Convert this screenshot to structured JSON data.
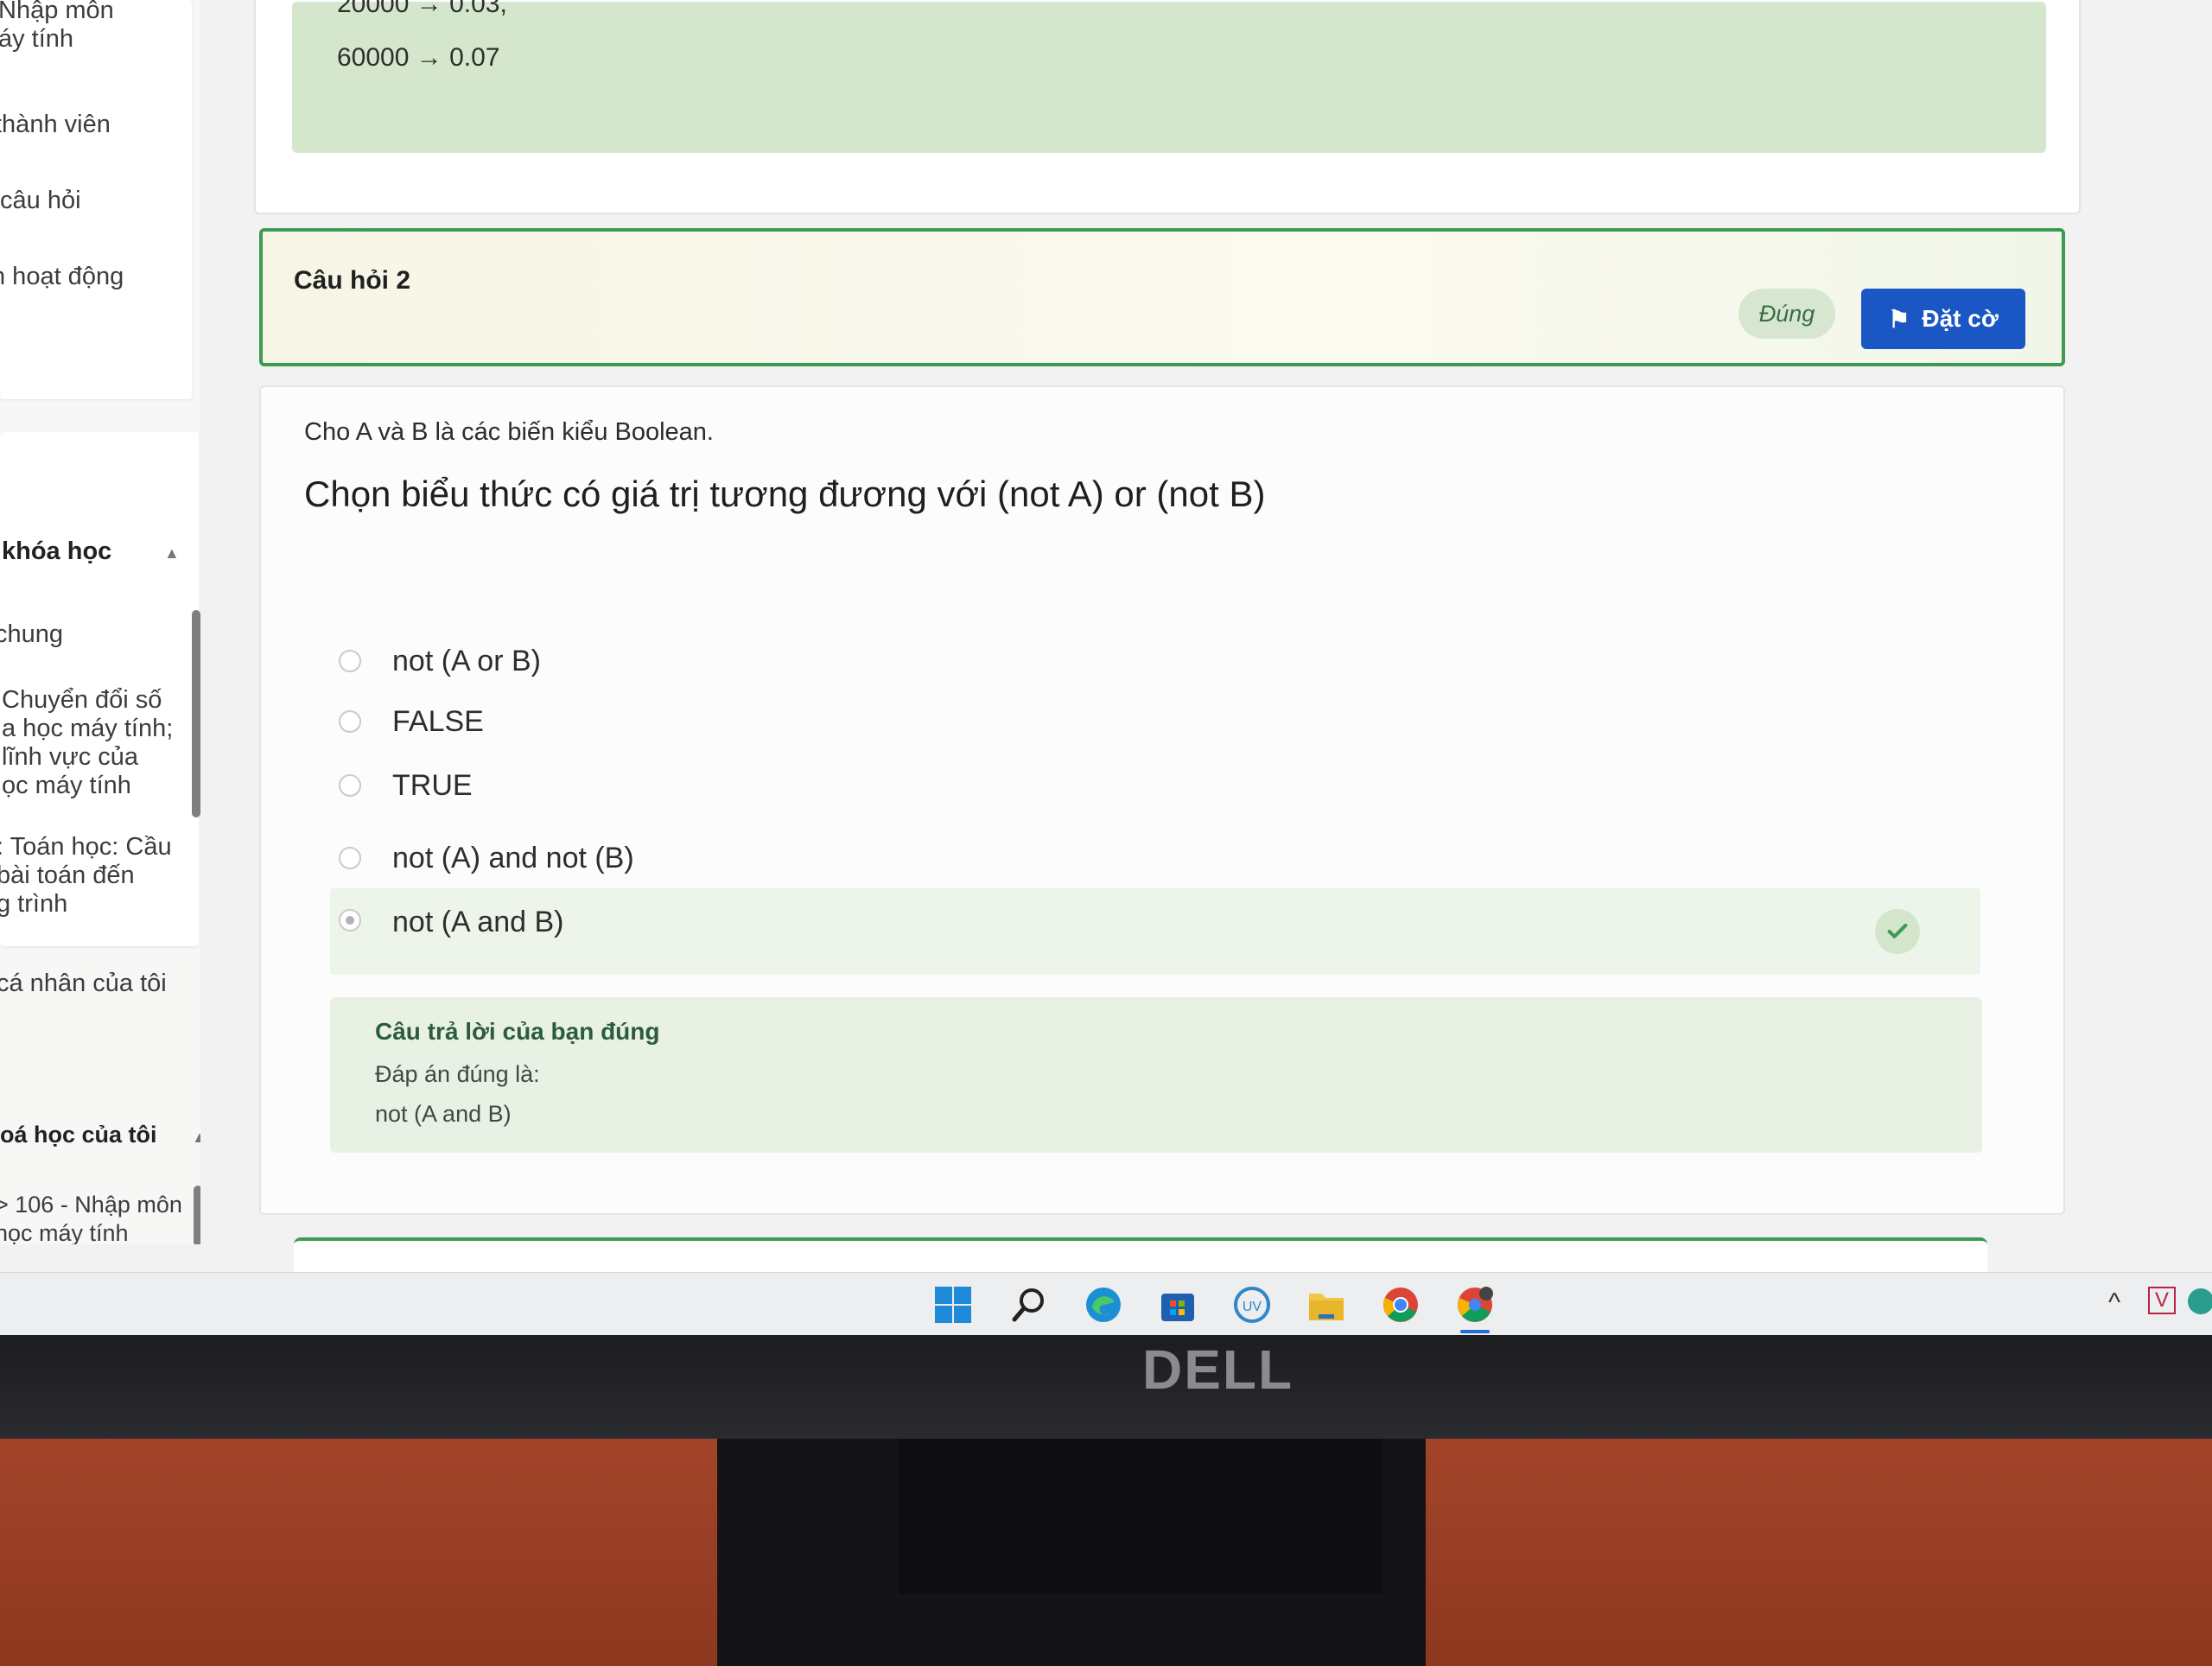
{
  "sidebar": {
    "course_title": "Nhập môn\náy tính",
    "nav_items": [
      "thành viên",
      "câu hỏi",
      "h hoạt động"
    ],
    "section_header": "khóa học",
    "course_items": [
      "chung",
      "Chuyển đổi số\na học máy tính;\nlĩnh vực của\nọc máy tính",
      ": Toán học: Cầu\nbài toán đến\ng trình"
    ],
    "personal": "cá nhân của tôi",
    "my_courses_header": "oá học của tôi",
    "my_course_item": "> 106 - Nhập môn\nhọc máy tính"
  },
  "prev_feedback": {
    "lines": [
      "20000 → 0.03,",
      "60000 → 0.07"
    ]
  },
  "question": {
    "title": "Câu hỏi 2",
    "status": "Đúng",
    "flag_label": "Đặt cờ",
    "intro": "Cho A và B là các biến kiểu Boolean.",
    "text": "Chọn biểu thức có giá trị tương đương với (not A) or (not B)",
    "options": [
      {
        "label": "not (A or B)",
        "checked": false
      },
      {
        "label": "FALSE",
        "checked": false
      },
      {
        "label": "TRUE",
        "checked": false
      },
      {
        "label": "not (A) and not (B)",
        "checked": false
      },
      {
        "label": "not (A and B)",
        "checked": true
      }
    ],
    "feedback": {
      "title": "Câu trả lời của bạn đúng",
      "label": "Đáp án đúng là:",
      "answer": "not (A and B)"
    }
  },
  "taskbar": {
    "icons": [
      "windows-start-icon",
      "search-icon",
      "edge-icon",
      "store-icon",
      "ultraviewer-icon",
      "file-explorer-icon",
      "chrome-icon",
      "chrome-profile-icon"
    ]
  },
  "monitor": {
    "brand": "DELL"
  },
  "colors": {
    "accent_green": "#3e9a52",
    "flag_blue": "#1a56c4",
    "feedback_green": "#e8f1e4"
  }
}
